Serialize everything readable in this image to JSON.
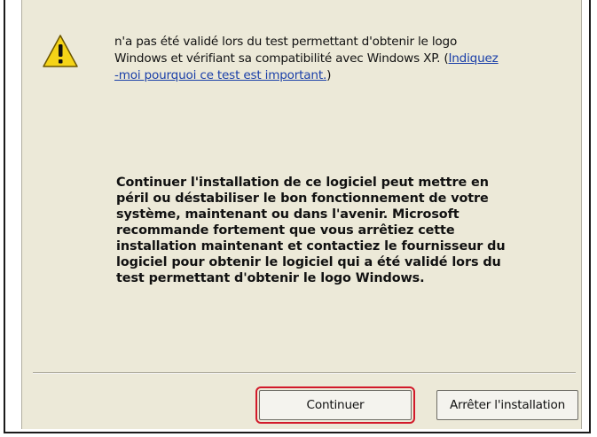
{
  "dialog": {
    "icon": "warning-icon",
    "intro_lines": [
      "n'a pas été validé lors du test permettant d'obtenir le logo",
      "Windows et vérifiant sa compatibilité avec Windows XP. ("
    ],
    "link_part1": "Indiquez",
    "link_part2": "-moi pourquoi ce test est important.",
    "link_close": ")",
    "warning_lines": [
      "Continuer l'installation de ce logiciel peut mettre en",
      "péril ou déstabiliser le bon fonctionnement de votre",
      "système, maintenant ou dans l'avenir. Microsoft",
      "recommande fortement que vous arrêtiez cette",
      "installation maintenant et contactiez le fournisseur du",
      "logiciel pour obtenir le logiciel qui a été validé lors du",
      "test permettant d'obtenir le logo Windows."
    ]
  },
  "buttons": {
    "continue_label": "Continuer",
    "stop_label": "Arrêter l'installation"
  },
  "colors": {
    "dialog_bg": "#ece9d8",
    "link": "#1a3fa8",
    "highlight": "#d21a2a",
    "warning_yellow": "#f5d417"
  }
}
